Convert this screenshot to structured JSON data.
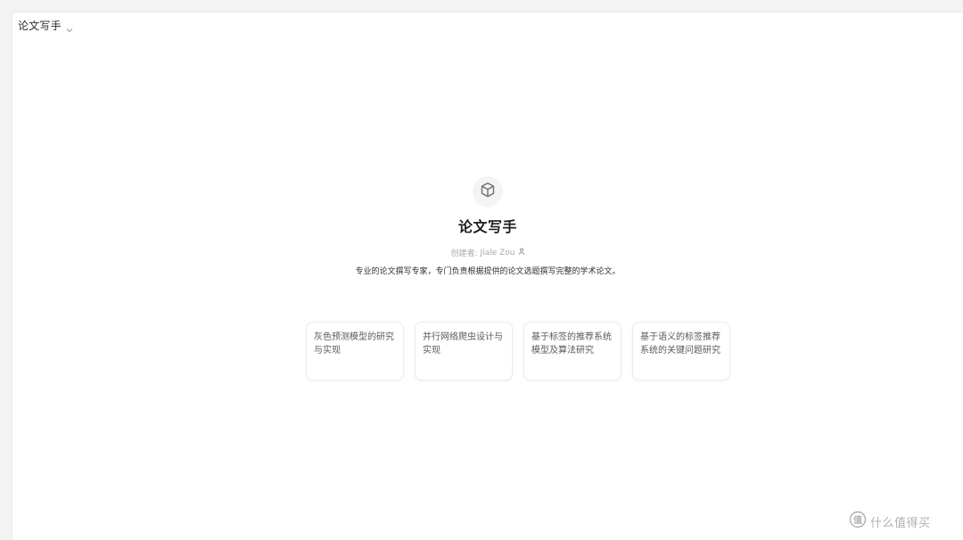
{
  "header": {
    "title": "论文写手",
    "dropdown_icon": "chevron-down-icon"
  },
  "bot": {
    "icon": "cube-icon",
    "name": "论文写手",
    "creator_label": "创建者:",
    "creator_name": "Jiale Zou",
    "creator_icon": "user-icon",
    "description": "专业的论文撰写专家，专门负责根据提供的论文选题撰写完整的学术论文。"
  },
  "suggestions": [
    "灰色预测模型的研究与实现",
    "并行网络爬虫设计与实现",
    "基于标签的推荐系统模型及算法研究",
    "基于语义的标签推荐系统的关键问题研究"
  ],
  "watermark": {
    "icon": "zhi-badge-icon",
    "text": "什么值得买"
  }
}
